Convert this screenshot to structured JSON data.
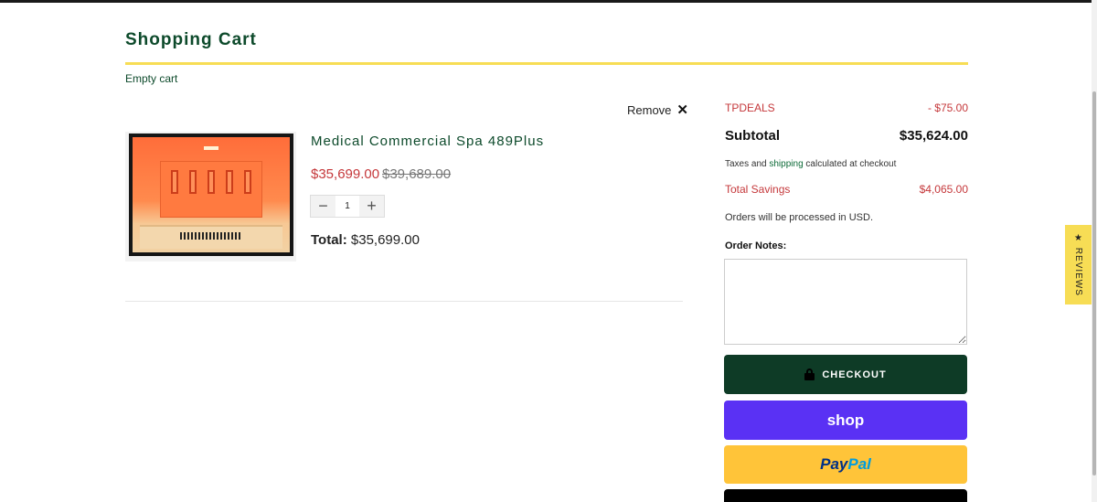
{
  "page": {
    "title": "Shopping Cart",
    "empty_cart": "Empty cart"
  },
  "item": {
    "remove_label": "Remove",
    "remove_icon": "✕",
    "name": "Medical Commercial Spa 489Plus",
    "price": "$35,699.00",
    "compare_price": "$39,689.00",
    "quantity": "1",
    "qty_minus": "−",
    "qty_plus": "+",
    "total_label": "Total:",
    "total_value": "$35,699.00"
  },
  "summary": {
    "discount_code": "TPDEALS",
    "discount_amount": "- $75.00",
    "subtotal_label": "Subtotal",
    "subtotal_value": "$35,624.00",
    "tax_note_before": "Taxes and ",
    "tax_note_link": "shipping",
    "tax_note_after": " calculated at checkout",
    "savings_label": "Total Savings",
    "savings_value": "$4,065.00",
    "currency_note": "Orders will be processed in USD.",
    "notes_label": "Order Notes:",
    "notes_value": ""
  },
  "buttons": {
    "checkout": "CHECKOUT",
    "shop_pay": "shop",
    "paypal_part1": "Pay",
    "paypal_part2": "Pal"
  },
  "reviews_tab": "★ REVIEWS",
  "colors": {
    "brand_green": "#0d4a2b",
    "accent_yellow": "#f7dd55",
    "sale_red": "#c5383b",
    "checkout_bg": "#0e3b26",
    "shop_pay_purple": "#5a31f4",
    "paypal_yellow": "#ffc439"
  },
  "icons": {
    "remove": "close-icon",
    "checkout": "lock-icon",
    "qty_minus": "minus-icon",
    "qty_plus": "plus-icon"
  }
}
